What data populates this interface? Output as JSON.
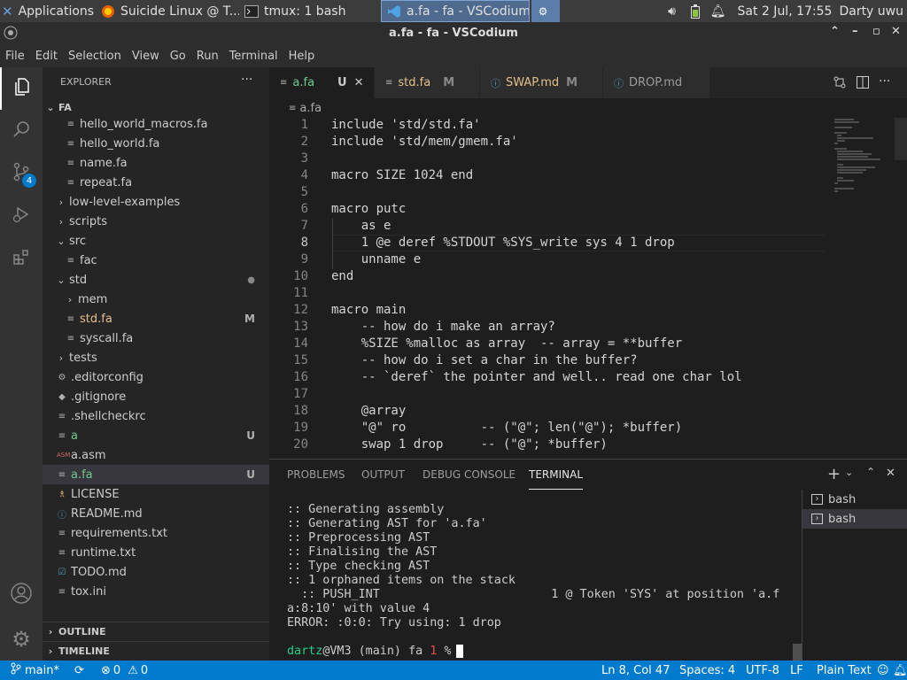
{
  "taskbar": {
    "applications": "Applications",
    "firefox": "Suicide Linux @ T...",
    "tmux": "tmux: 1 bash",
    "vscodium": "a.fa - fa - VSCodium",
    "clock": "Sat  2 Jul, 17:55",
    "user": "Darty uwu"
  },
  "window": {
    "title": "a.fa - fa - VSCodium",
    "controls": [
      "⌃",
      "–",
      "▫",
      "✕"
    ]
  },
  "menu": [
    "File",
    "Edit",
    "Selection",
    "View",
    "Go",
    "Run",
    "Terminal",
    "Help"
  ],
  "activity": {
    "scm_badge": "4"
  },
  "explorer": {
    "title": "EXPLORER",
    "more": "···",
    "root": "FA",
    "items": [
      {
        "label": "hello_world_macros.fa",
        "badge": ""
      },
      {
        "label": "hello_world.fa",
        "badge": ""
      },
      {
        "label": "name.fa",
        "badge": ""
      },
      {
        "label": "repeat.fa",
        "badge": ""
      },
      {
        "label": "low-level-examples",
        "badge": ""
      },
      {
        "label": "scripts",
        "badge": ""
      },
      {
        "label": "src",
        "badge": ""
      },
      {
        "label": "fac",
        "badge": ""
      },
      {
        "label": "std",
        "badge": "●"
      },
      {
        "label": "mem",
        "badge": ""
      },
      {
        "label": "std.fa",
        "badge": "M"
      },
      {
        "label": "syscall.fa",
        "badge": ""
      },
      {
        "label": "tests",
        "badge": ""
      },
      {
        "label": ".editorconfig",
        "badge": ""
      },
      {
        "label": ".gitignore",
        "badge": ""
      },
      {
        "label": ".shellcheckrc",
        "badge": ""
      },
      {
        "label": "a",
        "badge": "U"
      },
      {
        "label": "a.asm",
        "badge": ""
      },
      {
        "label": "a.fa",
        "badge": "U"
      },
      {
        "label": "LICENSE",
        "badge": ""
      },
      {
        "label": "README.md",
        "badge": ""
      },
      {
        "label": "requirements.txt",
        "badge": ""
      },
      {
        "label": "runtime.txt",
        "badge": ""
      },
      {
        "label": "TODO.md",
        "badge": ""
      },
      {
        "label": "tox.ini",
        "badge": ""
      }
    ],
    "outline": "OUTLINE",
    "timeline": "TIMELINE"
  },
  "tabs": [
    {
      "label": "a.fa",
      "badge": "U"
    },
    {
      "label": "std.fa",
      "badge": "M"
    },
    {
      "label": "SWAP.md",
      "badge": "M"
    },
    {
      "label": "DROP.md",
      "badge": ""
    }
  ],
  "breadcrumb": "a.fa",
  "editor": {
    "line_numbers": [
      "1",
      "2",
      "3",
      "4",
      "5",
      "6",
      "7",
      "8",
      "9",
      "10",
      "11",
      "12",
      "13",
      "14",
      "15",
      "16",
      "17",
      "18",
      "19",
      "20"
    ],
    "lines": [
      "include 'std/std.fa'",
      "include 'std/mem/gmem.fa'",
      "",
      "macro SIZE 1024 end",
      "",
      "macro putc",
      "    as e",
      "    1 @e deref %STDOUT %SYS_write sys 4 1 drop",
      "    unname e",
      "end",
      "",
      "macro main",
      "    -- how do i make an array?",
      "    %SIZE %malloc as array  -- array = **buffer",
      "    -- how do i set a char in the buffer?",
      "    -- `deref` the pointer and well.. read one char lol",
      "",
      "    @array",
      "    \"@\" ro          -- (\"@\"; len(\"@\"); *buffer)",
      "    swap 1 drop     -- (\"@\"; *buffer)"
    ]
  },
  "panel": {
    "tabs": [
      "PROBLEMS",
      "OUTPUT",
      "DEBUG CONSOLE",
      "TERMINAL"
    ],
    "terminal_lines": [
      ":: Generating assembly",
      ":: Generating AST for 'a.fa'",
      ":: Preprocessing AST",
      ":: Finalising the AST",
      ":: Type checking AST",
      ":: 1 orphaned items on the stack",
      "  :: PUSH_INT                        1 @ Token 'SYS' at position 'a.f",
      "a:8:10' with value 4",
      "ERROR: :0:0: Try using: 1 drop"
    ],
    "prompt": {
      "user": "dartz",
      "host": "@VM3",
      "branch": " (main) ",
      "dir": "fa",
      "code": " 1",
      "sign": " %"
    },
    "shells": [
      "bash",
      "bash"
    ]
  },
  "status": {
    "branch": "main*",
    "errors": "0",
    "warnings": "0",
    "position": "Ln 8, Col 47",
    "spaces": "Spaces: 4",
    "encoding": "UTF-8",
    "eol": "LF",
    "language": "Plain Text"
  }
}
